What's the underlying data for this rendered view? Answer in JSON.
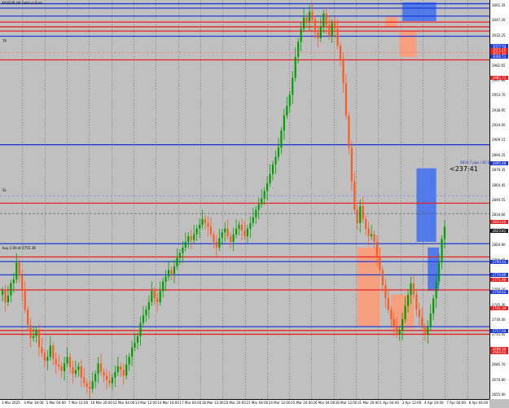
{
  "header": {
    "symbol_line": "XAUEUR,H4  Gold vs Euro"
  },
  "labels": {
    "tp": "TP",
    "sl": "SL",
    "left_order": "buy 2.00 at 2755.38",
    "ask_line": "4819.7 pips / 82.57",
    "countdown": "<237:41"
  },
  "price_axis": {
    "labels": [
      "3061.35",
      "3047.20",
      "3032.25",
      "2997.55",
      "2982.65",
      "2967.80",
      "2953.70",
      "2938.95",
      "2924.00",
      "2909.15",
      "2894.25",
      "2879.35",
      "2864.45",
      "2849.55",
      "2834.60",
      "2819.75",
      "2804.90",
      "2790.00",
      "2775.05",
      "2760.20",
      "2745.30",
      "2730.40",
      "2715.45",
      "2700.60",
      "2685.70",
      "2670.80",
      "2655.90"
    ],
    "tags": [
      {
        "value": "3019.94",
        "color": "#1f3bd6"
      },
      {
        "value": "3017.78",
        "color": "#1f3bd6"
      },
      {
        "value": "3015.56",
        "color": "#e82020"
      },
      {
        "value": "3013.65",
        "color": "#e82020"
      },
      {
        "value": "3011.40",
        "color": "#e82020"
      },
      {
        "value": "3008.71",
        "color": "#1f3bd6"
      },
      {
        "value": "2985.73",
        "color": "#e82020"
      },
      {
        "value": "2895.48",
        "color": "#1f3bd6"
      },
      {
        "value": "2833.40",
        "color": "#e82020"
      },
      {
        "value": "2823.81",
        "color": "#1f1f1f"
      },
      {
        "value": "2790.44",
        "color": "#1f3bd6"
      },
      {
        "value": "2776.89",
        "color": "#1f3bd6"
      },
      {
        "value": "2771.98",
        "color": "#e82020"
      },
      {
        "value": "2758.62",
        "color": "#1f3bd6"
      },
      {
        "value": "2741.39",
        "color": "#e82020"
      },
      {
        "value": "2717.04",
        "color": "#1f3bd6"
      },
      {
        "value": "2698.39",
        "color": "#e82020"
      },
      {
        "value": "2694.62",
        "color": "#e82020"
      }
    ]
  },
  "time_axis": {
    "labels": [
      "3 Mar 2025",
      "4 Mar 16:00",
      "5 Mar 04:00",
      "7 Mar 12:00",
      "10 Mar 20:00",
      "12 Mar 04:00",
      "13 Mar 12:00",
      "14 Mar 16:00",
      "17 Mar 04:00",
      "18 Mar 12:00",
      "20 Mar 20:00",
      "21 Mar 04:00",
      "24 Mar 12:00",
      "25 Mar 20:00",
      "26 Mar 04:00",
      "28 Mar 12:00",
      "31 Mar 20:00",
      "1 Apr 04:00",
      "3 Apr 12:00",
      "4 Apr 20:00",
      "7 Apr 04:00",
      "8 Apr 04:00"
    ]
  },
  "colors": {
    "background": "#c0c0c0",
    "bull": "#00a000",
    "bear": "#ff5a1e",
    "resistance": "#e82020",
    "support": "#1f3bd6",
    "zone_blue": "#3c6ef0",
    "zone_orange": "#ff9a73"
  },
  "chart_data": {
    "type": "candlestick",
    "y_range": [
      2647,
      3065
    ],
    "levels": [
      {
        "price": 3064.5,
        "color": "support"
      },
      {
        "price": 3059.8,
        "color": "support"
      },
      {
        "price": 3051.4,
        "color": "support"
      },
      {
        "price": 3045.0,
        "color": "resistance"
      },
      {
        "price": 3040.0,
        "color": "resistance"
      },
      {
        "price": 3035.5,
        "color": "resistance"
      },
      {
        "price": 3030.0,
        "color": "support"
      },
      {
        "price": 3005.0,
        "color": "resistance"
      },
      {
        "price": 2915.0,
        "color": "support"
      },
      {
        "price": 2853.0,
        "color": "resistance"
      },
      {
        "price": 2810.0,
        "color": "support"
      },
      {
        "price": 2796.0,
        "color": "resistance"
      },
      {
        "price": 2791.0,
        "color": "support"
      },
      {
        "price": 2777.0,
        "color": "support"
      },
      {
        "price": 2761.0,
        "color": "resistance"
      },
      {
        "price": 2722.0,
        "color": "support"
      },
      {
        "price": 2718.0,
        "color": "resistance"
      },
      {
        "price": 2714.0,
        "color": "resistance"
      }
    ],
    "closes": [
      2760,
      2748,
      2755,
      2768,
      2772,
      2790,
      2776,
      2760,
      2740,
      2724,
      2710,
      2712,
      2718,
      2700,
      2694,
      2686,
      2690,
      2702,
      2688,
      2682,
      2680,
      2675,
      2683,
      2690,
      2679,
      2672,
      2676,
      2680,
      2668,
      2662,
      2658,
      2656,
      2664,
      2672,
      2683,
      2674,
      2670,
      2665,
      2662,
      2668,
      2674,
      2680,
      2676,
      2670,
      2682,
      2690,
      2700,
      2705,
      2712,
      2726,
      2734,
      2740,
      2748,
      2760,
      2752,
      2748,
      2760,
      2770,
      2775,
      2782,
      2778,
      2786,
      2795,
      2800,
      2806,
      2812,
      2818,
      2814,
      2820,
      2826,
      2830,
      2836,
      2832,
      2828,
      2820,
      2812,
      2806,
      2816,
      2822,
      2826,
      2818,
      2812,
      2820,
      2826,
      2830,
      2824,
      2818,
      2826,
      2832,
      2838,
      2846,
      2852,
      2858,
      2866,
      2874,
      2884,
      2894,
      2902,
      2912,
      2930,
      2946,
      2956,
      2968,
      2986,
      3008,
      3024,
      3038,
      3050,
      3046,
      3056,
      3048,
      3034,
      3028,
      3040,
      3054,
      3042,
      3030,
      3044,
      3038,
      3020,
      3005,
      2980,
      2946,
      2912,
      2876,
      2846,
      2832,
      2850,
      2836,
      2826,
      2818,
      2820,
      2812,
      2796,
      2782,
      2766,
      2752,
      2740,
      2730,
      2722,
      2714,
      2718,
      2730,
      2744,
      2756,
      2768,
      2756,
      2740,
      2732,
      2722,
      2714,
      2722,
      2736,
      2752,
      2770,
      2790,
      2815,
      2828
    ]
  }
}
